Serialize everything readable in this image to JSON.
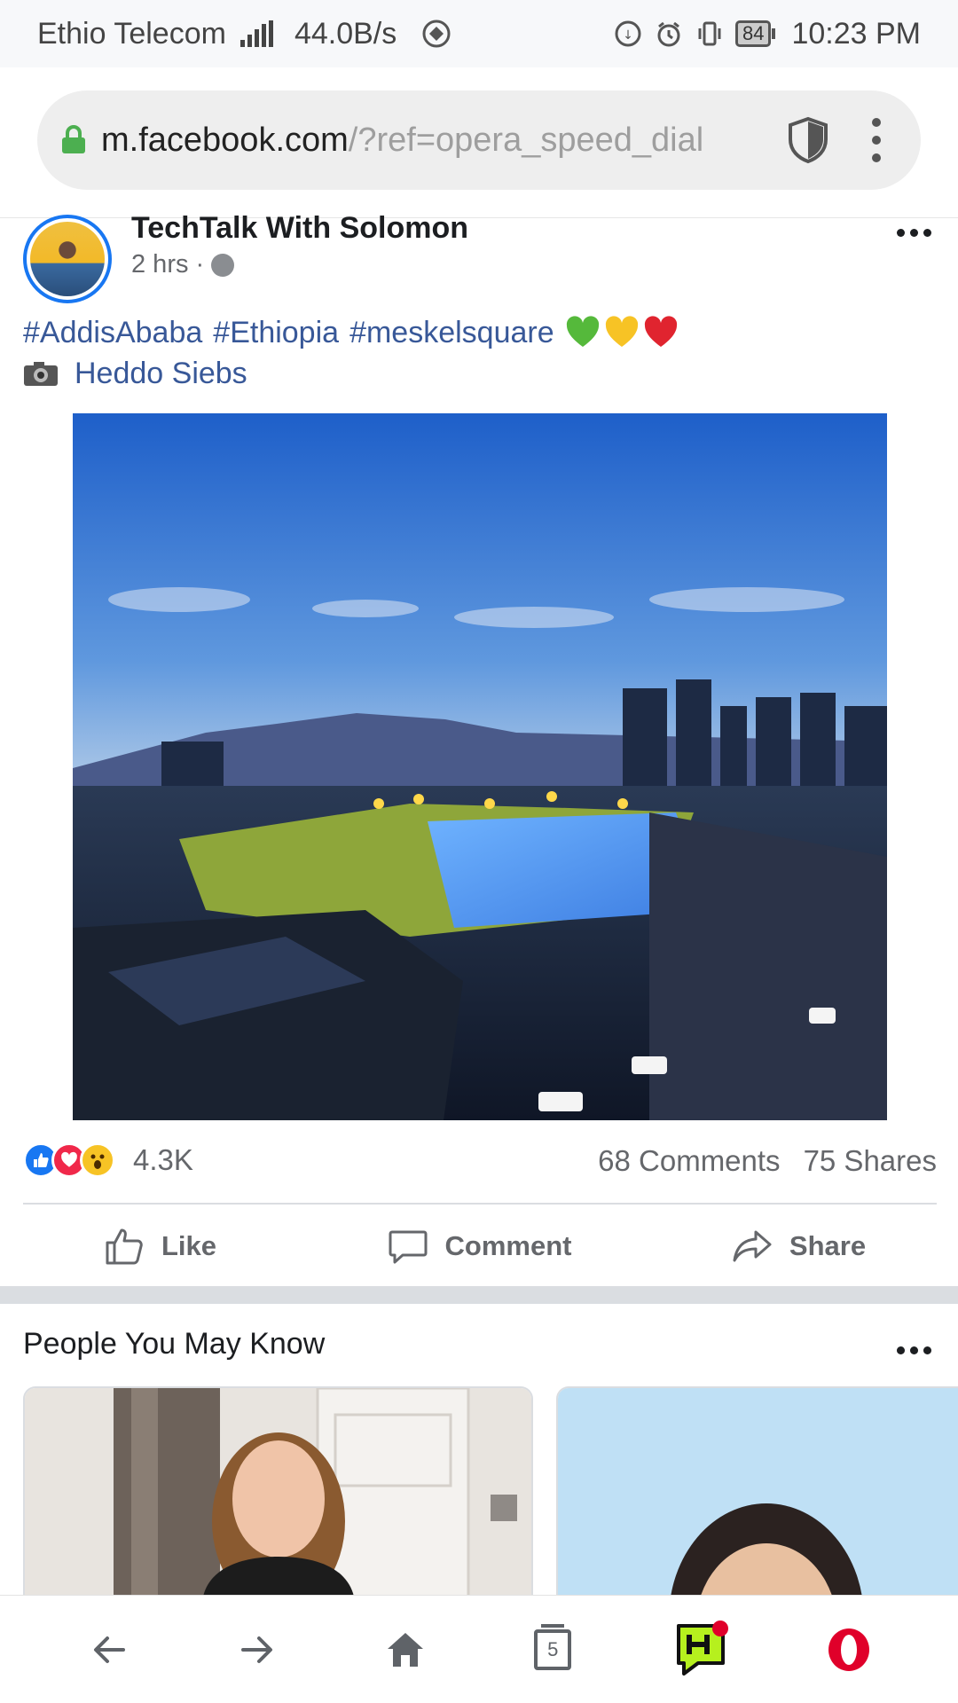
{
  "status_bar": {
    "carrier": "Ethio Telecom",
    "network_speed": "44.0B/s",
    "battery": "84",
    "time": "10:23 PM"
  },
  "address_bar": {
    "domain": "m.facebook.com",
    "path": "/?ref=opera_speed_dial"
  },
  "post": {
    "author": "TechTalk With Solomon",
    "time": "2 hrs",
    "separator": "·",
    "hashtags": [
      "#AddisAbaba",
      "#Ethiopia",
      "#meskelsquare"
    ],
    "photo_credit": "Heddo Siebs",
    "reaction_count": "4.3K",
    "comments": "68 Comments",
    "shares": "75 Shares",
    "actions": {
      "like": "Like",
      "comment": "Comment",
      "share": "Share"
    }
  },
  "people_you_may_know": {
    "title": "People You May Know"
  },
  "bottom_nav": {
    "tab_count": "5"
  },
  "colors": {
    "facebook_blue": "#1877f2",
    "link_blue": "#385898",
    "opera_red": "#e0002a"
  }
}
